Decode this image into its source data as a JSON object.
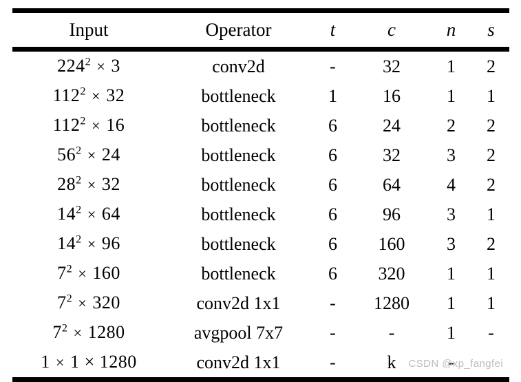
{
  "figure": {
    "name": "mobilenetv2-architecture-table",
    "accent_color": "#000000",
    "background_color": "#ffffff",
    "watermark": "CSDN @xp_fangfei"
  },
  "table": {
    "headers": {
      "input": "Input",
      "operator": "Operator",
      "t": "t",
      "c": "c",
      "n": "n",
      "s": "s"
    },
    "rows": [
      {
        "input_base": "224",
        "input_exp": "2",
        "input_times": "×",
        "input_channels": "3",
        "input_text": "224² × 3",
        "operator": "conv2d",
        "t": "-",
        "c": "32",
        "n": "1",
        "s": "2"
      },
      {
        "input_base": "112",
        "input_exp": "2",
        "input_times": "×",
        "input_channels": "32",
        "input_text": "112² × 32",
        "operator": "bottleneck",
        "t": "1",
        "c": "16",
        "n": "1",
        "s": "1"
      },
      {
        "input_base": "112",
        "input_exp": "2",
        "input_times": "×",
        "input_channels": "16",
        "input_text": "112² × 16",
        "operator": "bottleneck",
        "t": "6",
        "c": "24",
        "n": "2",
        "s": "2"
      },
      {
        "input_base": "56",
        "input_exp": "2",
        "input_times": "×",
        "input_channels": "24",
        "input_text": "56² × 24",
        "operator": "bottleneck",
        "t": "6",
        "c": "32",
        "n": "3",
        "s": "2"
      },
      {
        "input_base": "28",
        "input_exp": "2",
        "input_times": "×",
        "input_channels": "32",
        "input_text": "28² × 32",
        "operator": "bottleneck",
        "t": "6",
        "c": "64",
        "n": "4",
        "s": "2"
      },
      {
        "input_base": "14",
        "input_exp": "2",
        "input_times": "×",
        "input_channels": "64",
        "input_text": "14² × 64",
        "operator": "bottleneck",
        "t": "6",
        "c": "96",
        "n": "3",
        "s": "1"
      },
      {
        "input_base": "14",
        "input_exp": "2",
        "input_times": "×",
        "input_channels": "96",
        "input_text": "14² × 96",
        "operator": "bottleneck",
        "t": "6",
        "c": "160",
        "n": "3",
        "s": "2"
      },
      {
        "input_base": "7",
        "input_exp": "2",
        "input_times": "×",
        "input_channels": "160",
        "input_text": "7² × 160",
        "operator": "bottleneck",
        "t": "6",
        "c": "320",
        "n": "1",
        "s": "1"
      },
      {
        "input_base": "7",
        "input_exp": "2",
        "input_times": "×",
        "input_channels": "320",
        "input_text": "7² × 320",
        "operator": "conv2d 1x1",
        "t": "-",
        "c": "1280",
        "n": "1",
        "s": "1"
      },
      {
        "input_base": "7",
        "input_exp": "2",
        "input_times": "×",
        "input_channels": "1280",
        "input_text": "7² × 1280",
        "operator": "avgpool 7x7",
        "t": "-",
        "c": "-",
        "n": "1",
        "s": "-"
      },
      {
        "input_base": "1",
        "input_exp": "",
        "input_times": "×",
        "input_channels": "1 × 1280",
        "input_text": "1 × 1 × 1280",
        "operator": "conv2d 1x1",
        "t": "-",
        "c": "k",
        "n": "-",
        "s": ""
      }
    ]
  }
}
